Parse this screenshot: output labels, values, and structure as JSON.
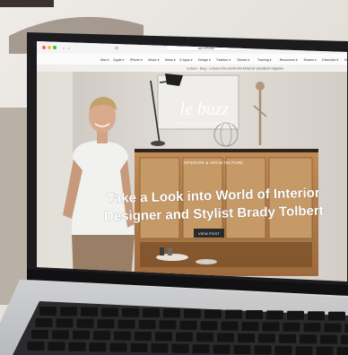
{
  "browser": {
    "url": "site-url.com",
    "tab_title": "Le Buzz – Blog – Le Buzz is the world's first influencer specialized magazine",
    "menu_items": [
      "Mac",
      "Apple",
      "iPhone",
      "Music",
      "News",
      "D Apps",
      "Design",
      "Fashion",
      "Stories",
      "Training",
      "Resources",
      "Movies",
      "Extended",
      "Neighbor"
    ]
  },
  "site": {
    "logo": "le buzz",
    "tagline": "DESIGN & PLACES & FASHION",
    "category": "INTERIOR & ARCHITECTURE",
    "headline_line1": "Take a Look into World of Interior",
    "headline_line2": "Designer and Stylist Brady Tolbert",
    "cta": "VIEW POST"
  },
  "colors": {
    "laptop_bezel": "#1c1c1e",
    "cabinet_wood": "#b07a45",
    "room_wall": "#dcd8d2",
    "headline_text": "#ffffff"
  }
}
